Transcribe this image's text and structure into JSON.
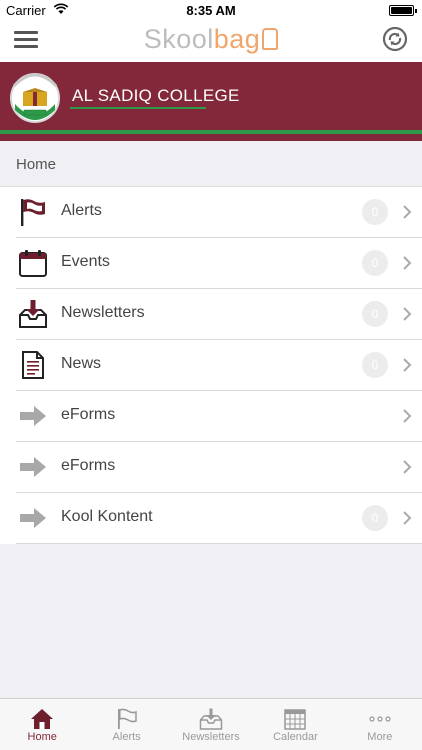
{
  "status_bar": {
    "carrier": "Carrier",
    "time": "8:35 AM"
  },
  "nav": {
    "logo_part1": "Skool",
    "logo_part2": "bag"
  },
  "banner": {
    "school_name": "AL SADIQ COLLEGE"
  },
  "section": {
    "title": "Home"
  },
  "list": {
    "items": [
      {
        "label": "Alerts",
        "icon": "flag-icon",
        "badge": "0"
      },
      {
        "label": "Events",
        "icon": "calendar-icon",
        "badge": "0"
      },
      {
        "label": "Newsletters",
        "icon": "inbox-download-icon",
        "badge": "0"
      },
      {
        "label": "News",
        "icon": "document-icon",
        "badge": "0"
      },
      {
        "label": "eForms",
        "icon": "arrow-right-icon"
      },
      {
        "label": "eForms",
        "icon": "arrow-right-icon"
      },
      {
        "label": "Kool Kontent",
        "icon": "arrow-right-icon",
        "badge": "0"
      }
    ]
  },
  "tabs": [
    {
      "label": "Home",
      "icon": "home-icon",
      "active": true
    },
    {
      "label": "Alerts",
      "icon": "flag-icon"
    },
    {
      "label": "Newsletters",
      "icon": "inbox-download-icon"
    },
    {
      "label": "Calendar",
      "icon": "calendar-grid-icon"
    },
    {
      "label": "More",
      "icon": "more-dots-icon"
    }
  ],
  "colors": {
    "brand_maroon": "#83283a",
    "brand_green": "#2d9a4a",
    "logo_grey": "#bcbcbc",
    "logo_orange": "#f0a56c"
  }
}
